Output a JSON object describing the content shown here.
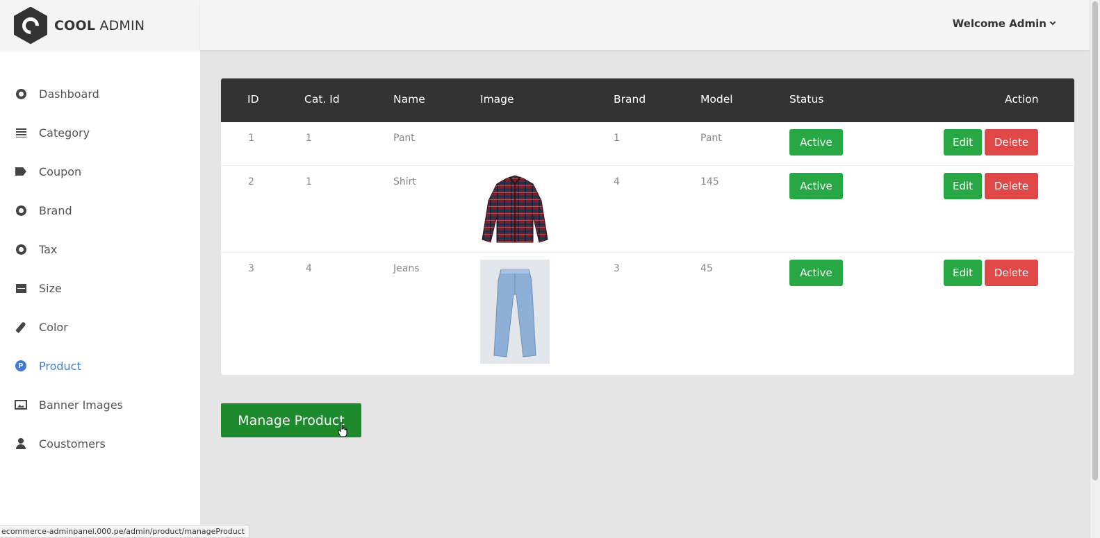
{
  "brand": {
    "bold": "COOL",
    "light": "ADMIN"
  },
  "header": {
    "welcome": "Welcome Admin"
  },
  "sidebar": {
    "items": [
      {
        "label": "Dashboard",
        "icon": "dashboard-icon"
      },
      {
        "label": "Category",
        "icon": "list-icon"
      },
      {
        "label": "Coupon",
        "icon": "tags-icon"
      },
      {
        "label": "Brand",
        "icon": "circle-icon"
      },
      {
        "label": "Tax",
        "icon": "circle-icon"
      },
      {
        "label": "Size",
        "icon": "card-icon"
      },
      {
        "label": "Color",
        "icon": "paint-brush-icon"
      },
      {
        "label": "Product",
        "icon": "product-p-icon",
        "active": true
      },
      {
        "label": "Banner Images",
        "icon": "images-icon"
      },
      {
        "label": "Coustomers",
        "icon": "user-icon"
      }
    ]
  },
  "table": {
    "headers": {
      "id": "ID",
      "cat": "Cat. Id",
      "name": "Name",
      "image": "Image",
      "brand": "Brand",
      "model": "Model",
      "status": "Status",
      "action": "Action"
    },
    "rows": [
      {
        "id": "1",
        "cat": "1",
        "name": "Pant",
        "brand": "1",
        "model": "Pant",
        "image": "",
        "status": "Active",
        "edit": "Edit",
        "delete": "Delete"
      },
      {
        "id": "2",
        "cat": "1",
        "name": "Shirt",
        "brand": "4",
        "model": "145",
        "image": "shirt",
        "status": "Active",
        "edit": "Edit",
        "delete": "Delete"
      },
      {
        "id": "3",
        "cat": "4",
        "name": "Jeans",
        "brand": "3",
        "model": "45",
        "image": "jeans",
        "status": "Active",
        "edit": "Edit",
        "delete": "Delete"
      }
    ]
  },
  "manage_button": "Manage Product",
  "status_url": "ecommerce-adminpanel.000.pe/admin/product/manageProduct",
  "colors": {
    "accent_green": "#28a745",
    "danger_red": "#e04848",
    "active_blue": "#3f7ad8",
    "table_header": "#333333"
  }
}
